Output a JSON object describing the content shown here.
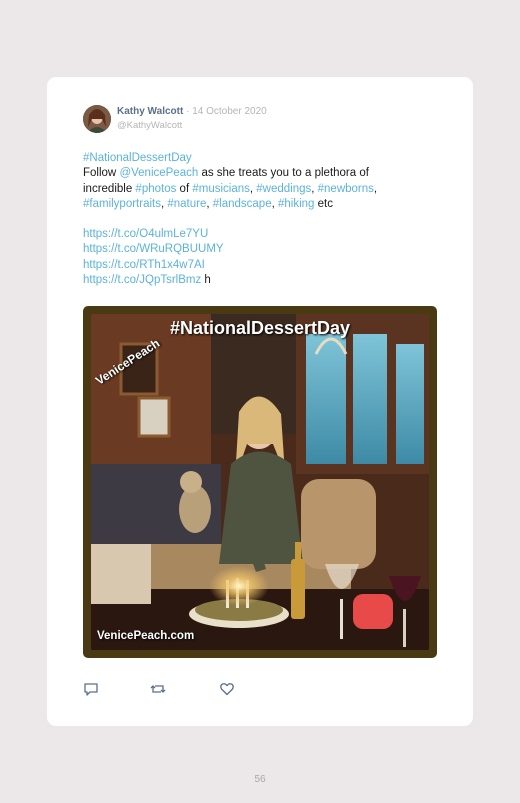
{
  "tweet": {
    "author_name": "Kathy Walcott",
    "separator": "·",
    "date": "14 October 2020",
    "handle": "@KathyWalcott",
    "lines": {
      "l1_tag": "#NationalDessertDay",
      "l2_pre": "Follow ",
      "l2_mention": "@VenicePeach",
      "l2_post": " as she treats you to a plethora of",
      "l3_pre": "incredible ",
      "l3_tag1": "#photos",
      "l3_mid1": " of ",
      "l3_tag2": "#musicians",
      "l3_mid2": ", ",
      "l3_tag3": "#weddings",
      "l3_mid3": ", ",
      "l3_tag4": "#newborns",
      "l3_post": ",",
      "l4_tag1": "#familyportraits",
      "l4_mid1": ", ",
      "l4_tag2": "#nature",
      "l4_mid2": ", ",
      "l4_tag3": "#landscape",
      "l4_mid3": ", ",
      "l4_tag4": "#hiking",
      "l4_post": " etc"
    },
    "links": [
      "https://t.co/O4ulmLe7YU",
      "https://t.co/WRuRQBUUMY",
      "https://t.co/RTh1x4w7AI",
      "https://t.co/JQpTsrlBmz"
    ],
    "link_suffix": " h"
  },
  "photo": {
    "title_overlay": "#NationalDessertDay",
    "watermark": "VenicePeach",
    "footer_overlay": "VenicePeach.com"
  },
  "actions": {
    "reply_icon": "reply-icon",
    "retweet_icon": "retweet-icon",
    "like_icon": "heart-icon"
  },
  "page_number": "56",
  "colors": {
    "link": "#5bb3d9",
    "author": "#5a6f8a",
    "background": "#ece8e9",
    "frame": "#4a3a14"
  }
}
